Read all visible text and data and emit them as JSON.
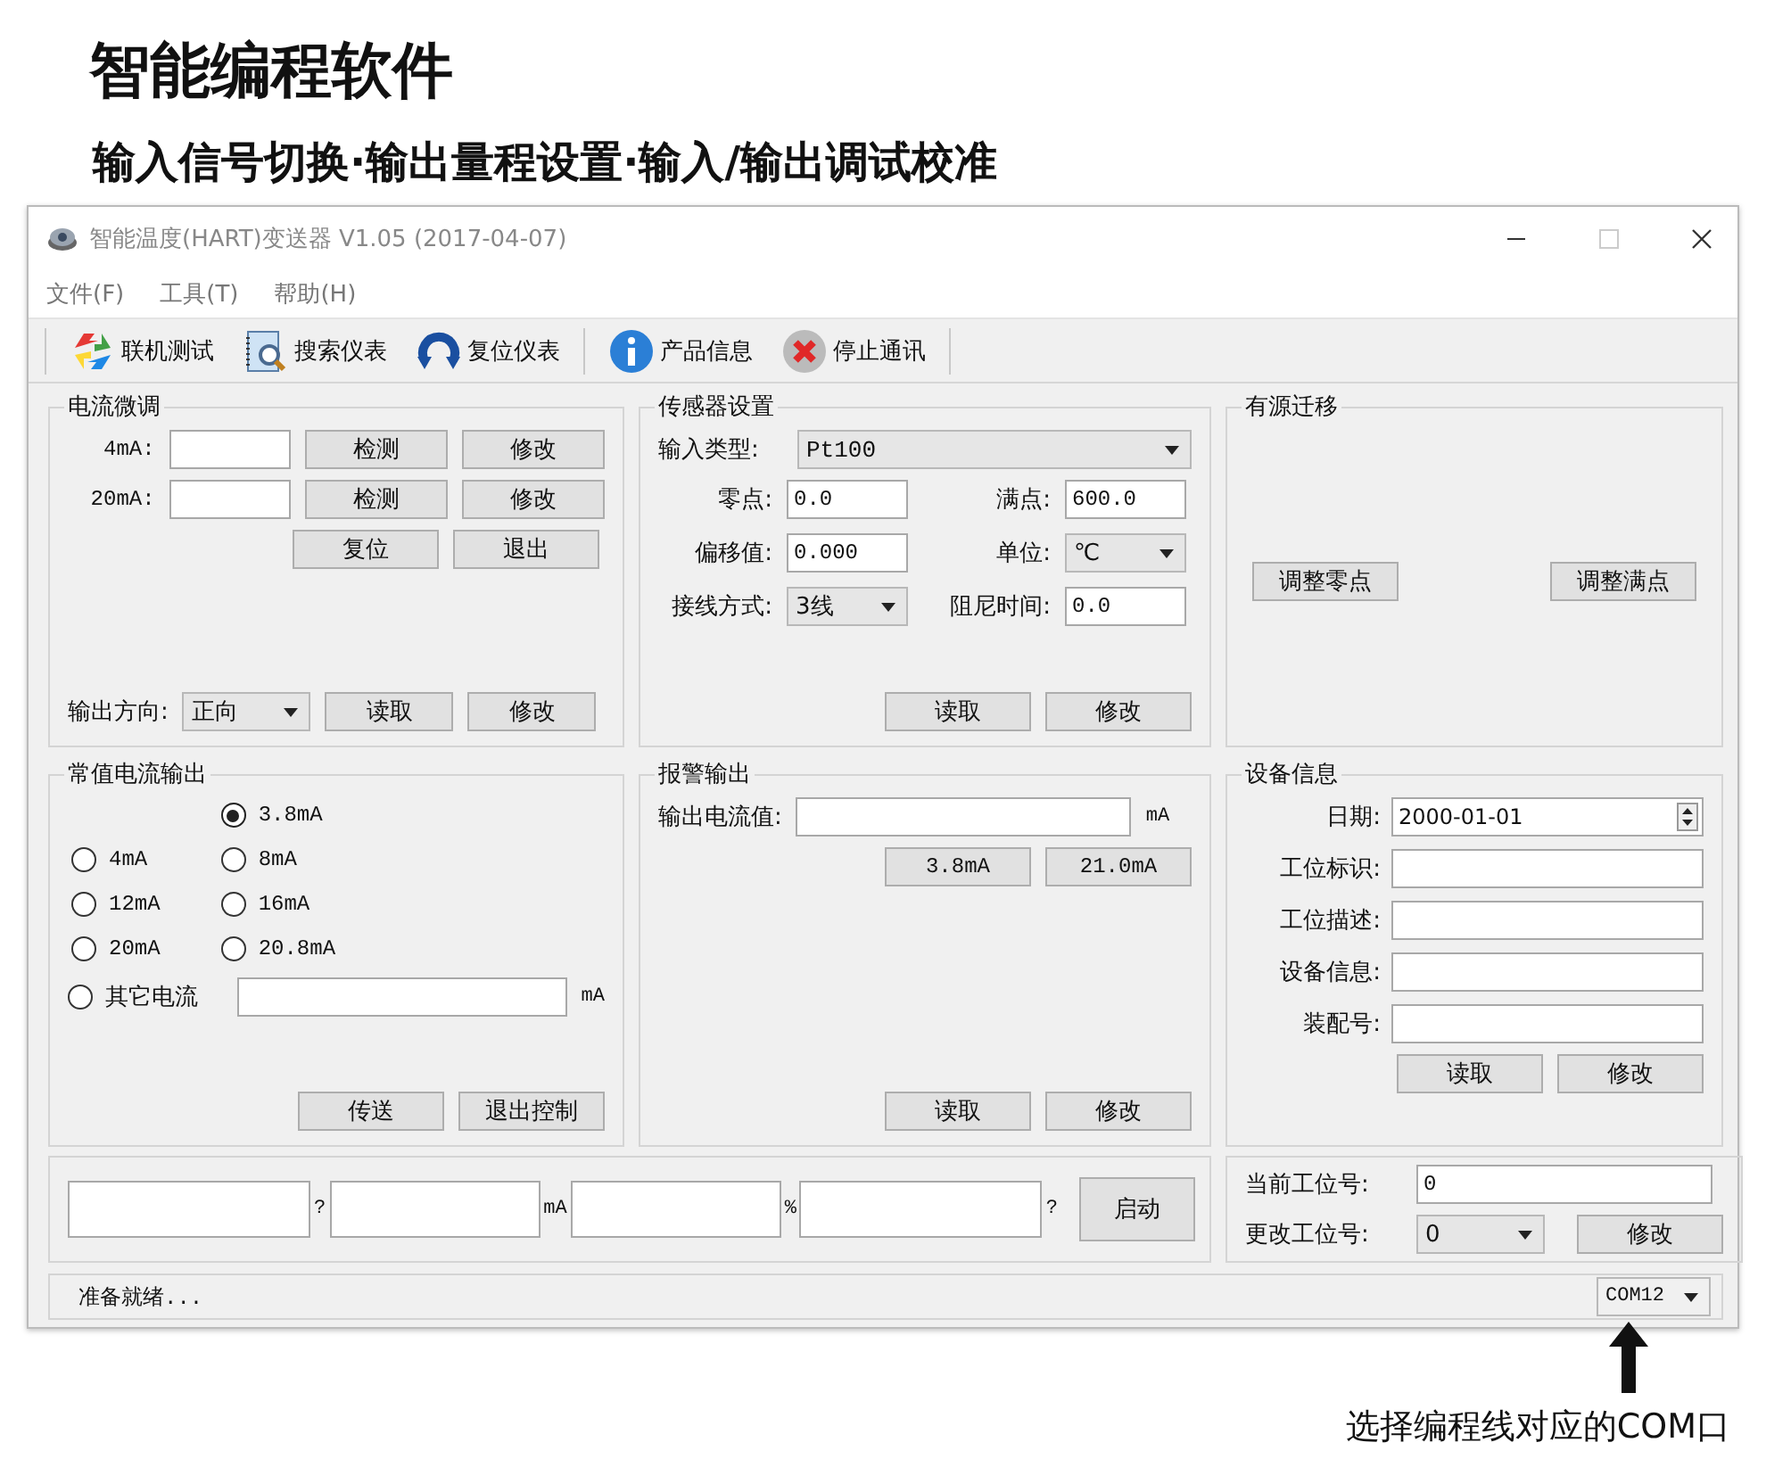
{
  "headline": "智能编程软件",
  "subheadline": "输入信号切换·输出量程设置·输入/输出调试校准",
  "window": {
    "title": "智能温度(HART)变送器 V1.05 (2017-04-07)"
  },
  "menu": [
    "文件(F)",
    "工具(T)",
    "帮助(H)"
  ],
  "toolbar": [
    [
      {
        "label": "联机测试",
        "kind": "connect"
      },
      {
        "label": "搜索仪表",
        "kind": "search"
      },
      {
        "label": "复位仪表",
        "kind": "reset"
      }
    ],
    [
      {
        "label": "产品信息",
        "kind": "info"
      },
      {
        "label": "停止通讯",
        "kind": "stop"
      }
    ]
  ],
  "current_trim": {
    "title": "电流微调",
    "rows": [
      {
        "label": "4mA:",
        "buttons": [
          "检测",
          "修改"
        ]
      },
      {
        "label": "20mA:",
        "buttons": [
          "检测",
          "修改"
        ]
      }
    ],
    "buttons": [
      "复位",
      "退出"
    ],
    "direction": {
      "label": "输出方向:",
      "value": "正向",
      "buttons": [
        "读取",
        "修改"
      ]
    }
  },
  "sensor": {
    "title": "传感器设置",
    "input_type": {
      "label": "输入类型:",
      "value": "Pt100"
    },
    "fields": [
      {
        "label": "零点:",
        "value": "0.0",
        "kind": "text"
      },
      {
        "label": "满点:",
        "value": "600.0",
        "kind": "text"
      },
      {
        "label": "偏移值:",
        "value": "0.000",
        "kind": "text"
      },
      {
        "label": "单位:",
        "value": "℃",
        "kind": "dropdown"
      },
      {
        "label": "接线方式:",
        "value": "3线",
        "kind": "dropdown"
      },
      {
        "label": "阻尼时间:",
        "value": "0.0",
        "kind": "text"
      }
    ],
    "buttons": [
      "读取",
      "修改"
    ]
  },
  "active_migration": {
    "title": "有源迁移",
    "buttons": [
      "调整零点",
      "调整满点"
    ]
  },
  "constant_output": {
    "title": "常值电流输出",
    "radio_columns": [
      [
        {
          "label": "4mA",
          "selected": false
        },
        {
          "label": "12mA",
          "selected": false
        },
        {
          "label": "20mA",
          "selected": false
        }
      ],
      [
        {
          "label": "3.8mA",
          "selected": true
        },
        {
          "label": "8mA",
          "selected": false
        },
        {
          "label": "16mA",
          "selected": false
        },
        {
          "label": "20.8mA",
          "selected": false
        }
      ]
    ],
    "other": {
      "label": "其它电流",
      "selected": false,
      "unit": "mA"
    },
    "buttons": [
      "传送",
      "退出控制"
    ]
  },
  "alarm": {
    "title": "报警输出",
    "label": "输出电流值:",
    "unit": "mA",
    "presets": [
      "3.8mA",
      "21.0mA"
    ],
    "buttons": [
      "读取",
      "修改"
    ]
  },
  "device_info": {
    "title": "设备信息",
    "date": {
      "label": "日期:",
      "value": "2000-01-01"
    },
    "fields": [
      {
        "label": "工位标识:"
      },
      {
        "label": "工位描述:"
      },
      {
        "label": "设备信息:"
      },
      {
        "label": "装配号:"
      }
    ],
    "buttons": [
      "读取",
      "修改"
    ]
  },
  "readout": {
    "units": [
      "?",
      "mA",
      "%",
      "?"
    ],
    "button": "启动"
  },
  "station": {
    "current": {
      "label": "当前工位号:",
      "value": "0"
    },
    "change": {
      "label": "更改工位号:",
      "value": "0"
    },
    "button": "修改"
  },
  "status_bar": {
    "text": "准备就绪...",
    "port": "COM12"
  },
  "callout": "选择编程线对应的COM口"
}
